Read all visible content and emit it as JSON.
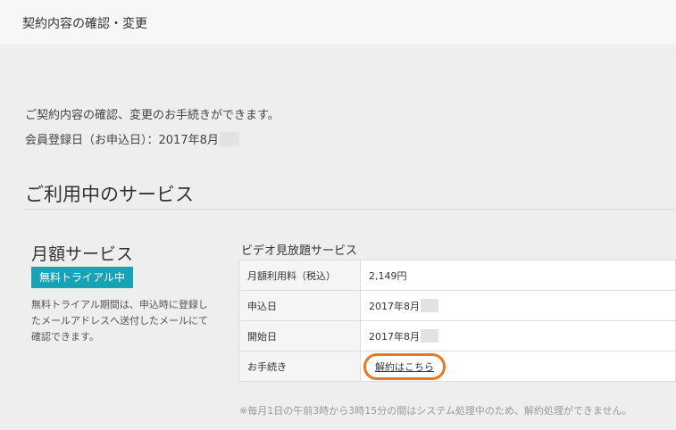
{
  "header": {
    "title": "契約内容の確認・変更"
  },
  "intro": {
    "line1": "ご契約内容の確認、変更のお手続きができます。",
    "line2": "会員登録日（お申込日）：2017年8月"
  },
  "section": {
    "title": "ご利用中のサービス"
  },
  "plan": {
    "name": "月額サービス",
    "badge": "無料トライアル中",
    "badge_color": "#17a2b8",
    "note": "無料トライアル期間は、申込時に登録したメールアドレスへ送付したメールにて確認できます。"
  },
  "service": {
    "title": "ビデオ見放題サービス",
    "rows": [
      {
        "label": "月額利用料（税込）",
        "value": "2,149円"
      },
      {
        "label": "申込日",
        "value": "2017年8月"
      },
      {
        "label": "開始日",
        "value": "2017年8月"
      },
      {
        "label": "お手続き",
        "value": "解約はこちら"
      }
    ],
    "highlight_color": "#e87722"
  },
  "footnote": "※毎月1日の午前3時から3時15分の間はシステム処理中のため、解約処理ができません。"
}
